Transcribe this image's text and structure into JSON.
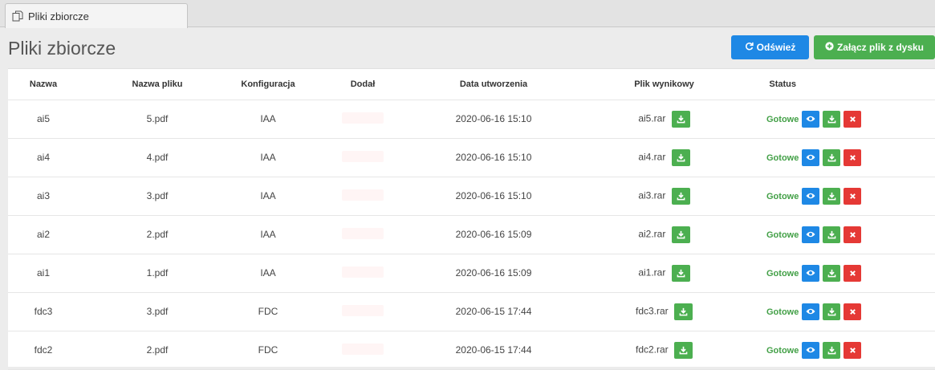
{
  "tab": {
    "label": "Pliki zbiorcze"
  },
  "header": {
    "title": "Pliki zbiorcze",
    "refresh_label": "Odśwież",
    "attach_label": "Załącz plik z dysku"
  },
  "colors": {
    "primary": "#1e88e5",
    "success": "#4caf50",
    "danger": "#e53935",
    "status_ok": "#43a047"
  },
  "table": {
    "columns": [
      "Nazwa",
      "Nazwa pliku",
      "Konfiguracja",
      "Dodał",
      "Data utworzenia",
      "Plik wynikowy",
      "Status",
      ""
    ],
    "rows": [
      {
        "name": "ai5",
        "file": "5.pdf",
        "config": "IAA",
        "added_by": "",
        "created": "2020-06-16 15:10",
        "result": "ai5.rar",
        "status": "Gotowe"
      },
      {
        "name": "ai4",
        "file": "4.pdf",
        "config": "IAA",
        "added_by": "",
        "created": "2020-06-16 15:10",
        "result": "ai4.rar",
        "status": "Gotowe"
      },
      {
        "name": "ai3",
        "file": "3.pdf",
        "config": "IAA",
        "added_by": "",
        "created": "2020-06-16 15:10",
        "result": "ai3.rar",
        "status": "Gotowe"
      },
      {
        "name": "ai2",
        "file": "2.pdf",
        "config": "IAA",
        "added_by": "",
        "created": "2020-06-16 15:09",
        "result": "ai2.rar",
        "status": "Gotowe"
      },
      {
        "name": "ai1",
        "file": "1.pdf",
        "config": "IAA",
        "added_by": "",
        "created": "2020-06-16 15:09",
        "result": "ai1.rar",
        "status": "Gotowe"
      },
      {
        "name": "fdc3",
        "file": "3.pdf",
        "config": "FDC",
        "added_by": "",
        "created": "2020-06-15 17:44",
        "result": "fdc3.rar",
        "status": "Gotowe"
      },
      {
        "name": "fdc2",
        "file": "2.pdf",
        "config": "FDC",
        "added_by": "",
        "created": "2020-06-15 17:44",
        "result": "fdc2.rar",
        "status": "Gotowe"
      }
    ]
  },
  "icons": {
    "tab": "files-icon",
    "refresh": "refresh-icon",
    "attach": "plus-circle-icon",
    "download": "download-icon",
    "view": "eye-icon",
    "delete": "close-icon"
  }
}
